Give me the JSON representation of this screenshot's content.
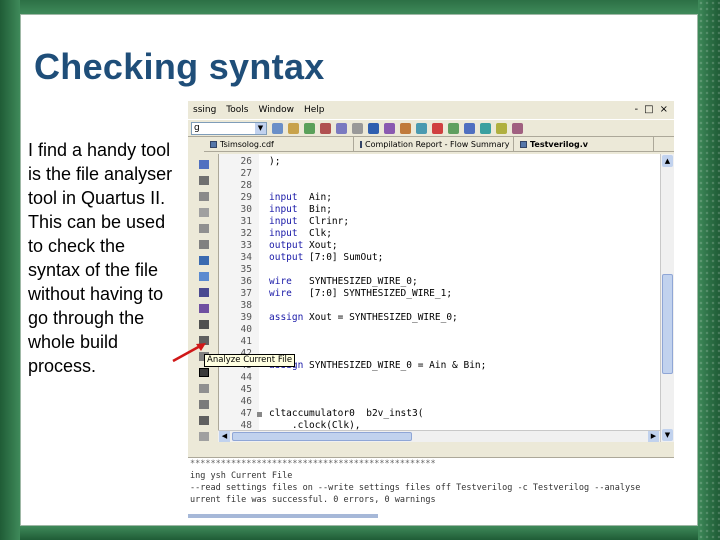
{
  "slide": {
    "title": "Checking syntax",
    "body": "I find a handy tool is the file analyser tool in Quartus II. This can be used to check the syntax of the file without having to go through the whole build process."
  },
  "app": {
    "menu": [
      "ssing",
      "Tools",
      "Window",
      "Help"
    ],
    "window_controls": [
      "-",
      "□",
      "×"
    ],
    "toolbar_combo": "g",
    "tabs": [
      {
        "label": "Tsimsolog.cdf"
      },
      {
        "label": "Compilation Report - Flow Summary"
      },
      {
        "label": "Testverilog.v"
      }
    ],
    "tooltip": "Analyze Current File",
    "code_lines": [
      {
        "n": "26",
        "text": ");"
      },
      {
        "n": "27",
        "text": ""
      },
      {
        "n": "28",
        "text": ""
      },
      {
        "n": "29",
        "kw": "input",
        "text": "  Ain;"
      },
      {
        "n": "30",
        "kw": "input",
        "text": "  Bin;"
      },
      {
        "n": "31",
        "kw": "input",
        "text": "  Clrinr;"
      },
      {
        "n": "32",
        "kw": "input",
        "text": "  Clk;"
      },
      {
        "n": "33",
        "kw": "output",
        "text": " Xout;"
      },
      {
        "n": "34",
        "kw": "output",
        "text": " [7:0] SumOut;"
      },
      {
        "n": "35",
        "text": ""
      },
      {
        "n": "36",
        "kw": "wire",
        "text": "   SYNTHESIZED_WIRE_0;"
      },
      {
        "n": "37",
        "kw": "wire",
        "text": "   [7:0] SYNTHESIZED_WIRE_1;"
      },
      {
        "n": "38",
        "text": ""
      },
      {
        "n": "39",
        "kw": "assign",
        "text": " Xout = SYNTHESIZED_WIRE_0;"
      },
      {
        "n": "40",
        "text": ""
      },
      {
        "n": "41",
        "text": ""
      },
      {
        "n": "42",
        "text": ""
      },
      {
        "n": "43",
        "kw": "assign",
        "text": " SYNTHESIZED_WIRE_0 = Ain & Bin;"
      },
      {
        "n": "44",
        "text": ""
      },
      {
        "n": "45",
        "text": ""
      },
      {
        "n": "46",
        "text": ""
      },
      {
        "n": "47",
        "text": "cltaccumulator0  b2v_inst3("
      },
      {
        "n": "48",
        "text": "    .clock(Clk),"
      }
    ],
    "console_lines": [
      "************************************************",
      "ing ysh Current File",
      "--read settings files on --write settings files off Testverilog -c Testverilog --analyse",
      "urrent file was successful. 0 errors, 0 warnings"
    ]
  }
}
